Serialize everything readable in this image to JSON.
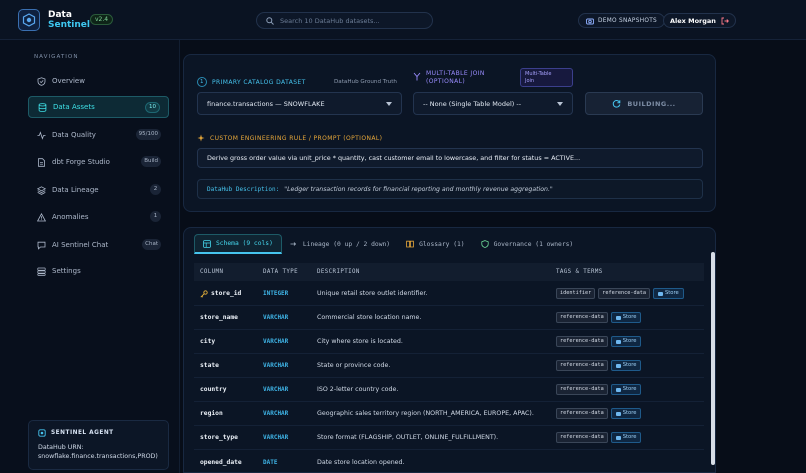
{
  "app": {
    "title_line1": "Data",
    "title_line2": "Sentinel",
    "version": "v2.4"
  },
  "search": {
    "placeholder": "Search 10 DataHub datasets..."
  },
  "header": {
    "demo_label": "DEMO SNAPSHOTS",
    "user_name": "Alex Morgan"
  },
  "sidebar": {
    "section_title": "NAVIGATION",
    "items": [
      {
        "label": "Overview",
        "badge": "",
        "icon": "shield-icon"
      },
      {
        "label": "Data Assets",
        "badge": "10",
        "icon": "database-icon"
      },
      {
        "label": "Data Quality",
        "badge": "95/100",
        "icon": "activity-icon"
      },
      {
        "label": "dbt Forge Studio",
        "badge": "Build",
        "icon": "file-code-icon"
      },
      {
        "label": "Data Lineage",
        "badge": "2",
        "icon": "layers-icon"
      },
      {
        "label": "Anomalies",
        "badge": "1",
        "icon": "alert-triangle-icon"
      },
      {
        "label": "AI Sentinel Chat",
        "badge": "Chat",
        "icon": "chat-icon"
      },
      {
        "label": "Settings",
        "badge": "",
        "icon": "settings-icon"
      }
    ],
    "agent": {
      "title": "SENTINEL AGENT",
      "line1": "DataHub URN:",
      "line2": "snowflake.finance.transactions,PROD)"
    }
  },
  "builder": {
    "step1_num": "1",
    "step1_label": "PRIMARY CATALOG DATASET",
    "ground_truth": "DataHub Ground Truth",
    "step2_label_line1": "MULTI-TABLE JOIN",
    "step2_label_line2": "(OPTIONAL)",
    "multi_chip_line1": "Multi-Table",
    "multi_chip_line2": "Join",
    "primary_select": "finance.transactions — SNOWFLAKE",
    "join_select": "-- None (Single Table Model) --",
    "build_button": "BUILDING...",
    "rule_label": "CUSTOM ENGINEERING RULE / PROMPT (OPTIONAL)",
    "rule_value": "Derive gross order value via unit_price * quantity, cast customer email to lowercase, and filter for status = ACTIVE...",
    "desc_label": "DataHub Description:",
    "desc_value": "\"Ledger transaction records for financial reporting and monthly revenue aggregation.\""
  },
  "tabs": [
    {
      "label": "Schema (9 cols)",
      "icon": "table-icon"
    },
    {
      "label": "Lineage (0 up / 2 down)",
      "icon": "lineage-icon"
    },
    {
      "label": "Glossary (1)",
      "icon": "book-icon"
    },
    {
      "label": "Governance (1 owners)",
      "icon": "shield-icon"
    }
  ],
  "schema": {
    "headers": {
      "column": "COLUMN",
      "type": "DATA TYPE",
      "desc": "DESCRIPTION",
      "tags": "TAGS & TERMS"
    },
    "rows": [
      {
        "column": "store_id",
        "type": "INTEGER",
        "desc": "Unique retail store outlet identifier.",
        "tags": [
          "identifier",
          "reference-data"
        ],
        "term": "Store",
        "key": true
      },
      {
        "column": "store_name",
        "type": "VARCHAR",
        "desc": "Commercial store location name.",
        "tags": [
          "reference-data"
        ],
        "term": "Store"
      },
      {
        "column": "city",
        "type": "VARCHAR",
        "desc": "City where store is located.",
        "tags": [
          "reference-data"
        ],
        "term": "Store"
      },
      {
        "column": "state",
        "type": "VARCHAR",
        "desc": "State or province code.",
        "tags": [
          "reference-data"
        ],
        "term": "Store"
      },
      {
        "column": "country",
        "type": "VARCHAR",
        "desc": "ISO 2-letter country code.",
        "tags": [
          "reference-data"
        ],
        "term": "Store"
      },
      {
        "column": "region",
        "type": "VARCHAR",
        "desc": "Geographic sales territory region (NORTH_AMERICA, EUROPE, APAC).",
        "tags": [
          "reference-data"
        ],
        "term": "Store"
      },
      {
        "column": "store_type",
        "type": "VARCHAR",
        "desc": "Store format (FLAGSHIP, OUTLET, ONLINE_FULFILLMENT).",
        "tags": [
          "reference-data"
        ],
        "term": "Store"
      },
      {
        "column": "opened_date",
        "type": "DATE",
        "desc": "Date store location opened.",
        "tags": [],
        "term": ""
      }
    ]
  }
}
